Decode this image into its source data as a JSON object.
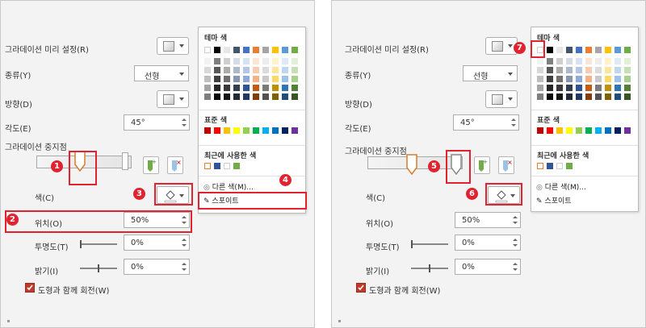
{
  "labels": {
    "gradient_preset": "그라데이션 미리 설정(R)",
    "type": "종류(Y)",
    "direction": "방향(D)",
    "angle": "각도(E)",
    "gradient_stops": "그라데이션 중지점",
    "color": "색(C)",
    "position": "위치(O)",
    "transparency": "투명도(T)",
    "brightness": "밝기(I)",
    "rotate_with_shape": "도형과 함께 회전(W)"
  },
  "values": {
    "type": "선형",
    "angle": "45°",
    "position": "50%",
    "transparency": "0%",
    "brightness": "0%",
    "transparency_level": 0,
    "brightness_level": 0,
    "rotate_checked": true
  },
  "menu": {
    "theme_colors": "테마 색",
    "standard_colors": "표준 색",
    "recent_colors": "최근에 사용한 색",
    "more_colors": "다른 색(M)...",
    "eyedropper": "스포이트"
  },
  "palette": {
    "theme_top": [
      "#ffffff",
      "#000000",
      "#e7e6e6",
      "#44546a",
      "#4472c4",
      "#ed7d31",
      "#a5a5a5",
      "#ffc000",
      "#5b9bd5",
      "#70ad47"
    ],
    "theme_shades": [
      [
        "#f2f2f2",
        "#7f7f7f",
        "#d0cece",
        "#d6dce4",
        "#d9e2f3",
        "#fbe5d5",
        "#ededed",
        "#fff2cc",
        "#deebf6",
        "#e2efd9"
      ],
      [
        "#d8d8d8",
        "#595959",
        "#aeabab",
        "#adb9ca",
        "#b4c6e7",
        "#f7cbac",
        "#dbdbdb",
        "#ffe598",
        "#bdd7ee",
        "#c5e0b3"
      ],
      [
        "#bfbfbf",
        "#3f3f3f",
        "#757070",
        "#8496b0",
        "#8eaadb",
        "#f4b183",
        "#c9c9c9",
        "#ffd965",
        "#9cc3e5",
        "#a8d08d"
      ],
      [
        "#a5a5a5",
        "#262626",
        "#3a3838",
        "#323f4f",
        "#2f5496",
        "#c55a11",
        "#7b7b7b",
        "#bf9000",
        "#2e75b5",
        "#538135"
      ],
      [
        "#7f7f7f",
        "#0c0c0c",
        "#171616",
        "#222a35",
        "#1f3864",
        "#833c0b",
        "#525252",
        "#7f6000",
        "#1e4e79",
        "#375623"
      ]
    ],
    "standard": [
      "#c00000",
      "#ff0000",
      "#ffc000",
      "#ffff00",
      "#92d050",
      "#00b050",
      "#00b0f0",
      "#0070c0",
      "#002060",
      "#7030a0"
    ],
    "recent": [
      "#ffffff",
      "#2f5597",
      "#ffffff",
      "#70ad47"
    ],
    "recent_first_outline": "#ed7d31",
    "accent_red": "#e1232f",
    "check_red": "#c0392b"
  },
  "badges": [
    "1",
    "2",
    "3",
    "4",
    "5",
    "6",
    "7"
  ]
}
